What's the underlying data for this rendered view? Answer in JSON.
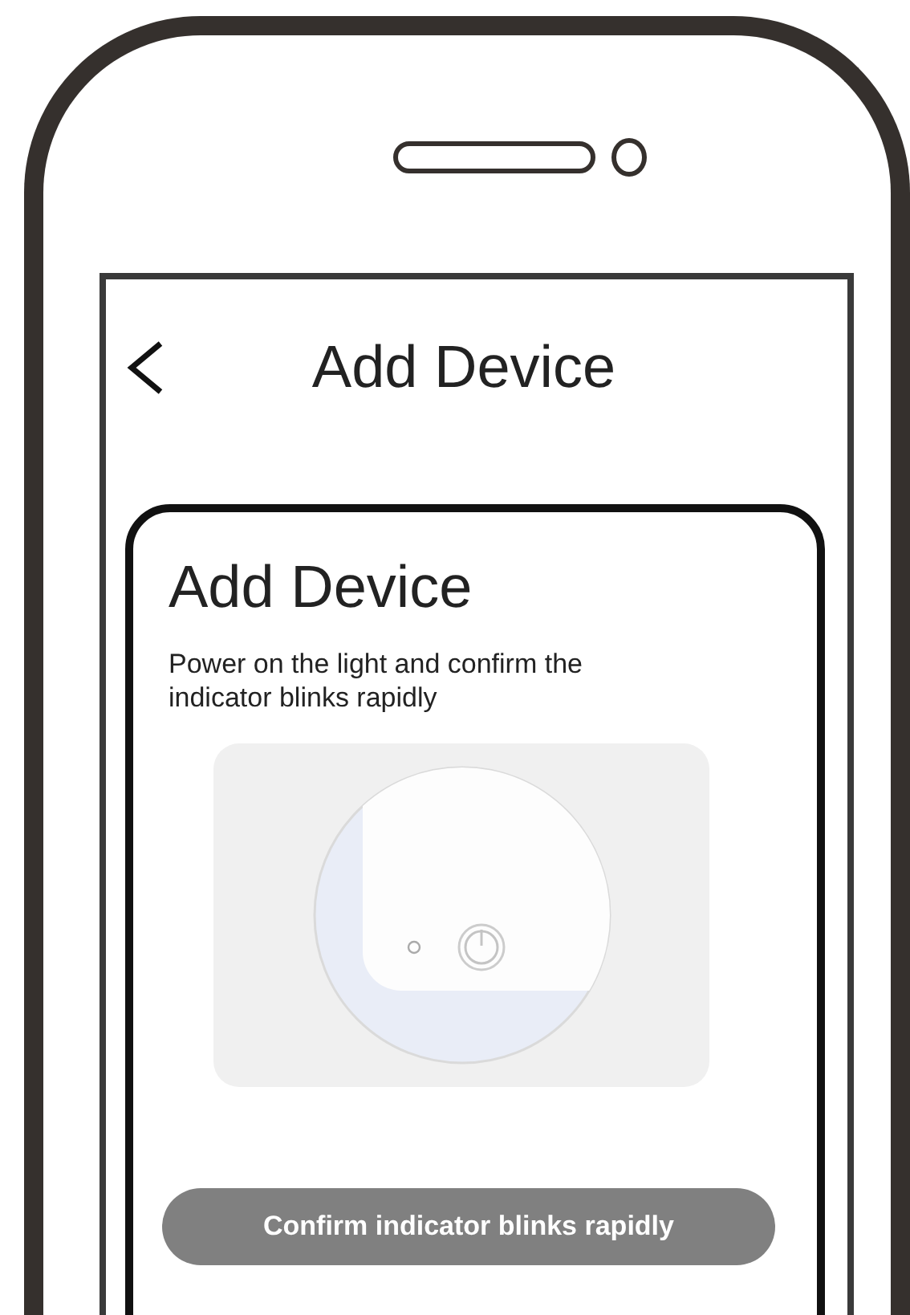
{
  "header": {
    "title": "Add Device"
  },
  "card": {
    "title": "Add Device",
    "description": "Power on the light and confirm the indicator blinks rapidly",
    "button": "Confirm indicator blinks rapidly"
  }
}
